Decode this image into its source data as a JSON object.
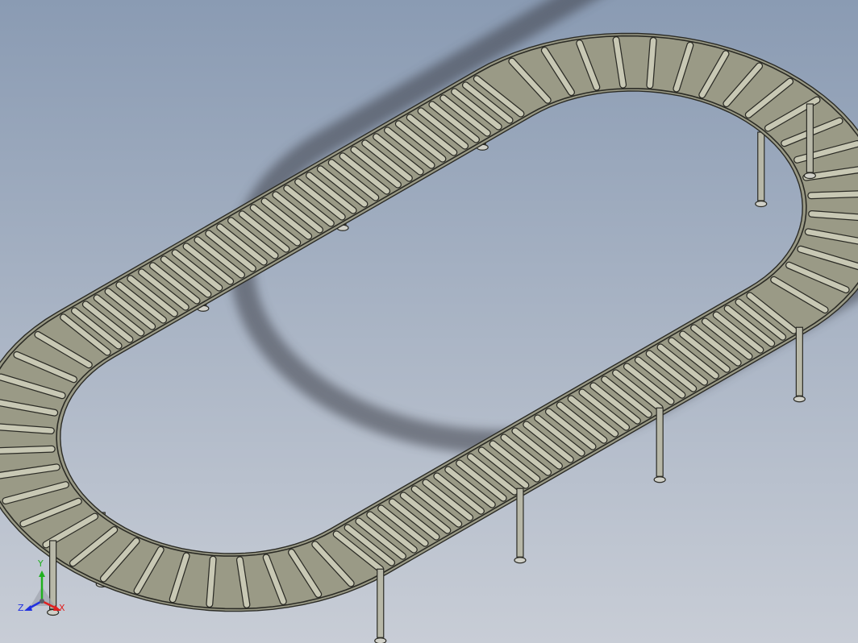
{
  "app": {
    "kind": "cad-3d-viewport"
  },
  "model": {
    "description_shown": "roller-conveyor-loop",
    "roller_count_estimate": 120,
    "leg_assembly_count": 12
  },
  "triad": {
    "axis_y_label": "Y",
    "axis_x_label": "X",
    "axis_z_label": "Z"
  },
  "colors": {
    "background_top": "#8a9bb3",
    "background_bottom": "#c8cdd6",
    "frame_stroke": "#2b2b25",
    "frame_fill": "#9a9a86",
    "roller_fill": "#c8c8b4",
    "axis_x": "#e02020",
    "axis_y": "#20b020",
    "axis_z": "#2030e0"
  }
}
